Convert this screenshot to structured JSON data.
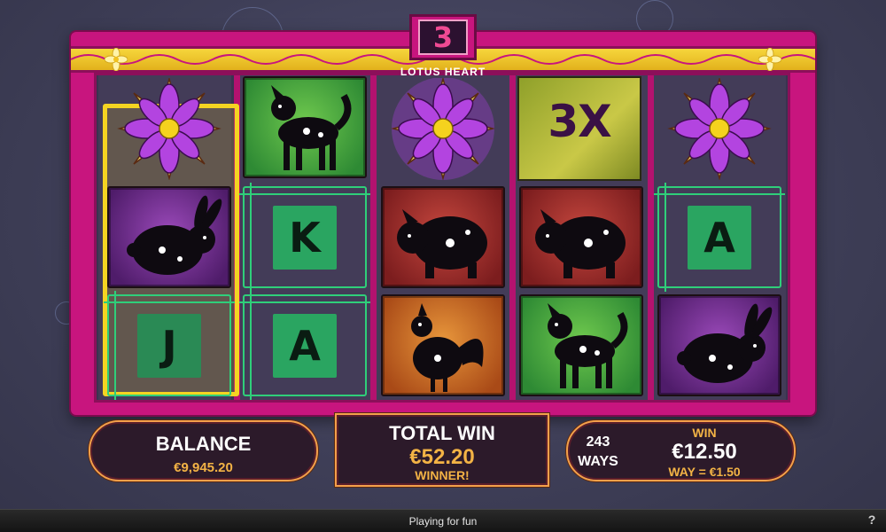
{
  "game": {
    "title": "LOTUS HEART",
    "badge_number": "3"
  },
  "reels": [
    [
      "lotus",
      "rabbit",
      "J"
    ],
    [
      "dog",
      "K",
      "A"
    ],
    [
      "lotus",
      "pig",
      "rooster"
    ],
    [
      "3x-wild",
      "pig",
      "dog"
    ],
    [
      "lotus",
      "A",
      "rabbit"
    ]
  ],
  "card_symbols": {
    "K": "K",
    "A": "A",
    "J": "J"
  },
  "wild_multiplier": "3X",
  "balance": {
    "label": "BALANCE",
    "value": "€9,945.20"
  },
  "total_win": {
    "label": "TOTAL WIN",
    "value": "€52.20",
    "status": "WINNER!"
  },
  "win": {
    "ways_count": "243",
    "ways_label": "WAYS",
    "label": "WIN",
    "value": "€12.50",
    "way_value": "WAY = €1.50"
  },
  "status_bar": {
    "text": "Playing for fun",
    "help": "?"
  },
  "colors": {
    "frame": "#c8157e",
    "band": "#f6d63c",
    "panel_border": "#f3a04b",
    "gold_text": "#f3b345",
    "card_green": "#2fcf7a",
    "win_highlight": "#f4d422"
  }
}
